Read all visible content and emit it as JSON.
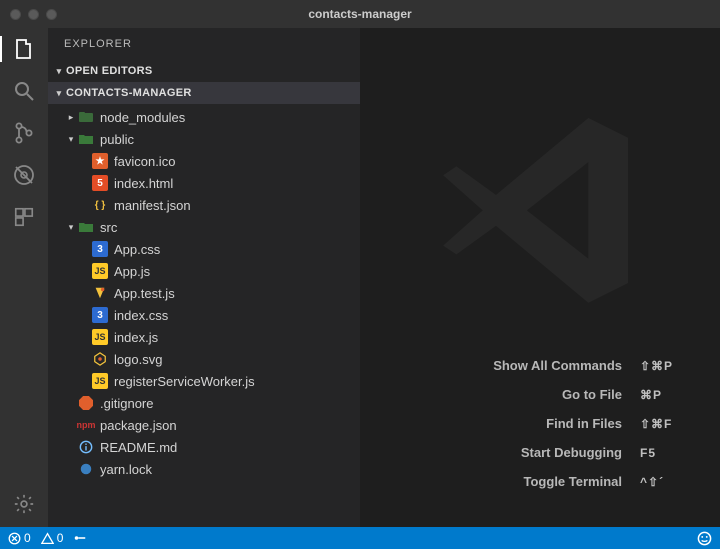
{
  "window": {
    "title": "contacts-manager"
  },
  "sidebar": {
    "title": "EXPLORER",
    "sections": {
      "openEditors": {
        "label": "OPEN EDITORS"
      },
      "project": {
        "label": "CONTACTS-MANAGER"
      }
    }
  },
  "tree": {
    "node_modules": "node_modules",
    "public": "public",
    "favicon": "favicon.ico",
    "indexhtml": "index.html",
    "manifest": "manifest.json",
    "src": "src",
    "appcss": "App.css",
    "appjs": "App.js",
    "apptest": "App.test.js",
    "indexcss": "index.css",
    "indexjs": "index.js",
    "logosvg": "logo.svg",
    "rsw": "registerServiceWorker.js",
    "gitignore": ".gitignore",
    "packagejson": "package.json",
    "readme": "README.md",
    "yarnlock": "yarn.lock"
  },
  "welcome": {
    "items": [
      {
        "label": "Show All Commands",
        "shortcut": "⇧⌘P"
      },
      {
        "label": "Go to File",
        "shortcut": "⌘P"
      },
      {
        "label": "Find in Files",
        "shortcut": "⇧⌘F"
      },
      {
        "label": "Start Debugging",
        "shortcut": "F5"
      },
      {
        "label": "Toggle Terminal",
        "shortcut": "^⇧´"
      }
    ]
  },
  "status": {
    "errors": "0",
    "warnings": "0"
  },
  "icons": {
    "files": "files",
    "search": "search",
    "git": "git",
    "debug": "debug",
    "extensions": "extensions",
    "settings": "settings"
  }
}
